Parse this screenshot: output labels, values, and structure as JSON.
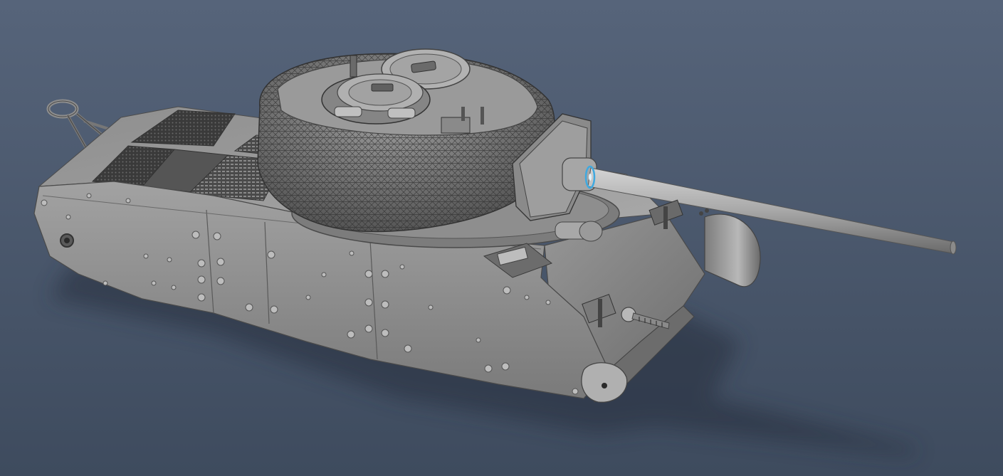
{
  "viewport": {
    "background_top": "#56647a",
    "background_bottom": "#3e4b5e",
    "model_color": "#8c8c8c",
    "model_dark": "#5c5c5c",
    "model_light": "#b4b4b4",
    "selection_highlight": "#3fa9e0",
    "shadow_color": "#2c3646"
  },
  "model": {
    "parts": [
      "hull-icon",
      "turret-icon",
      "gun-barrel-icon",
      "commander-hatch-icon",
      "loader-hatch-icon",
      "gun-mantlet-icon",
      "engine-deck-grille-icon",
      "tow-hook-icon",
      "headlight-icon",
      "bow-machine-gun-icon",
      "drive-sprocket-icon"
    ]
  }
}
